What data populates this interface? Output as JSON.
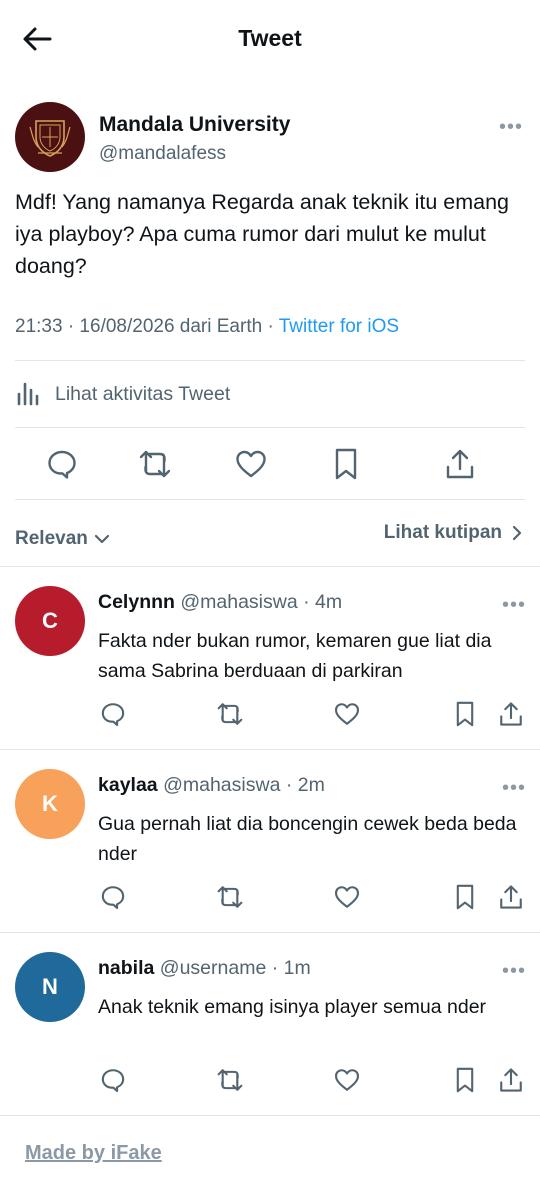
{
  "header": {
    "title": "Tweet"
  },
  "tweet": {
    "author_name": "Mandala University",
    "author_handle": "@mandalafess",
    "text": "Mdf! Yang namanya Regarda anak teknik itu emang iya playboy? Apa cuma rumor dari mulut ke mulut doang?",
    "timestamp": "21:33 · 16/08/2026 dari Earth · ",
    "source": "Twitter for iOS",
    "activity_label": "Lihat aktivitas Tweet"
  },
  "replies_bar": {
    "sort_label": "Relevan",
    "quotes_label": "Lihat kutipan"
  },
  "replies": [
    {
      "initial": "C",
      "name": "Celynnn",
      "handle_time": "@mahasiswa · 4m",
      "text": "Fakta nder bukan rumor, kemaren gue liat dia sama Sabrina berduaan di parkiran",
      "avatar_color": "#b71c2c"
    },
    {
      "initial": "K",
      "name": "kaylaa",
      "handle_time": "@mahasiswa · 2m",
      "text": "Gua pernah liat dia boncengin cewek beda beda nder",
      "avatar_color": "#f7a15a"
    },
    {
      "initial": "N",
      "name": "nabila",
      "handle_time": "@username · 1m",
      "text": "Anak teknik emang isinya player semua nder",
      "avatar_color": "#1f6a9a"
    }
  ],
  "footer": {
    "label": "Made by iFake"
  },
  "colors": {
    "link": "#1d9bf0",
    "secondary_text": "#536471",
    "main_avatar": "#4a1012"
  },
  "icons": [
    "back-arrow-icon",
    "more-icon",
    "university-logo-icon",
    "analytics-icon",
    "reply-icon",
    "retweet-icon",
    "like-icon",
    "bookmark-icon",
    "share-icon",
    "chevron-down-icon",
    "chevron-right-icon"
  ]
}
